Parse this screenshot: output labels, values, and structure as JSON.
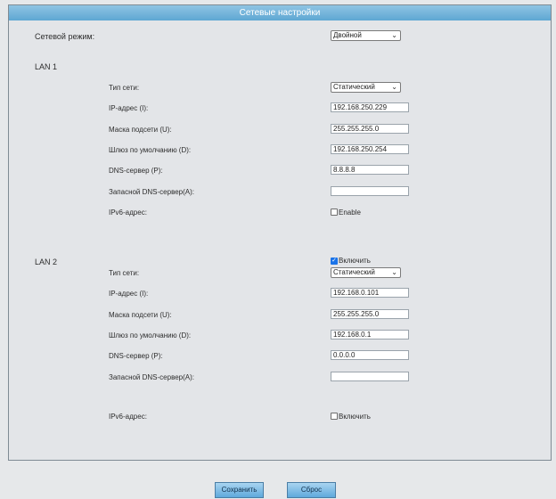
{
  "header": {
    "title": "Сетевые настройки"
  },
  "network_mode": {
    "label": "Сетевой режим:",
    "value": "Двойной"
  },
  "lan1": {
    "heading": "LAN 1",
    "type_label": "Тип сети:",
    "type_value": "Статический",
    "ip_label": "IP-адрес (I):",
    "ip_value": "192.168.250.229",
    "mask_label": "Маска подсети (U):",
    "mask_value": "255.255.255.0",
    "gateway_label": "Шлюз по умолчанию (D):",
    "gateway_value": "192.168.250.254",
    "dns_label": "DNS-сервер (P):",
    "dns_value": "8.8.8.8",
    "dns_alt_label": "Запасной DNS-сервер(A):",
    "dns_alt_value": "",
    "ipv6_label": "IPv6-адрес:",
    "ipv6_checkbox_label": "Enable",
    "ipv6_checked": false
  },
  "lan2": {
    "heading": "LAN 2",
    "enable_label": "Включить",
    "enabled": true,
    "type_label": "Тип сети:",
    "type_value": "Статический",
    "ip_label": "IP-адрес (I):",
    "ip_value": "192.168.0.101",
    "mask_label": "Маска подсети (U):",
    "mask_value": "255.255.255.0",
    "gateway_label": "Шлюз по умолчанию (D):",
    "gateway_value": "192.168.0.1",
    "dns_label": "DNS-сервер (P):",
    "dns_value": "0.0.0.0",
    "dns_alt_label": "Запасной DNS-сервер(A):",
    "dns_alt_value": "",
    "ipv6_label": "IPv6-адрес:",
    "ipv6_checkbox_label": "Включить",
    "ipv6_checked": false
  },
  "actions": {
    "save_label": "Сохранить",
    "reset_label": "Сброс"
  },
  "icons": {
    "dropdown": "chevron-down-icon",
    "checkmark": "checkmark-icon"
  },
  "colors": {
    "header_start": "#8fc4e3",
    "header_end": "#5ea7d3",
    "panel_bg": "#e3e5e8",
    "checkbox_checked": "#1a73e8"
  }
}
